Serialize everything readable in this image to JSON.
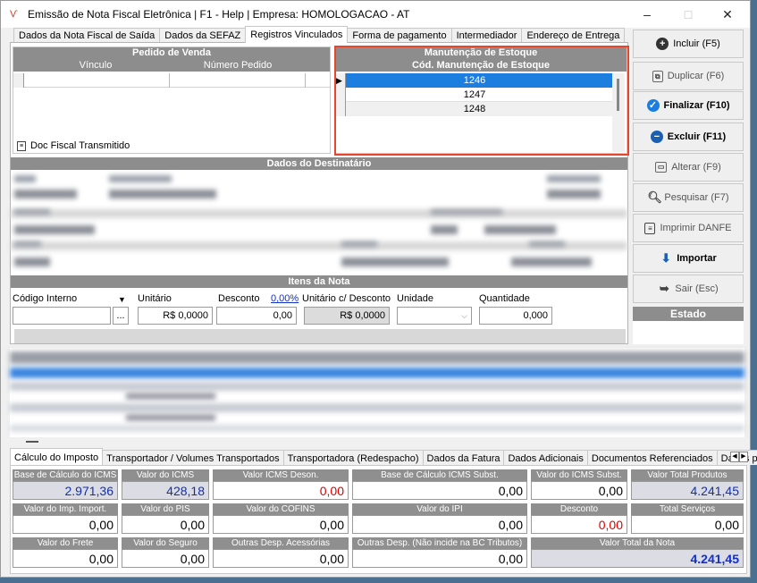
{
  "window": {
    "title": "Emissão de Nota Fiscal Eletrônica | F1 - Help | Empresa: HOMOLOGACAO - AT",
    "minimize": "–",
    "maximize": "□",
    "close": "✕"
  },
  "tabs": [
    "Dados da Nota Fiscal de Saída",
    "Dados da SEFAZ",
    "Registros Vinculados",
    "Forma de pagamento",
    "Intermediador",
    "Endereço de Entrega"
  ],
  "pedido": {
    "title": "Pedido de Venda",
    "col1": "Vínculo",
    "col2": "Número Pedido",
    "doc_label": "Doc Fiscal Transmitido"
  },
  "estoque": {
    "title": "Manutenção de Estoque",
    "col": "Cód. Manutenção de Estoque",
    "rows": [
      "1246",
      "1247",
      "1248"
    ]
  },
  "destinatario": {
    "title": "Dados  do Destinatário"
  },
  "itens": {
    "title": "Itens da Nota",
    "codigo_label": "Código Interno",
    "unitario_label": "Unitário",
    "desconto_label": "Desconto",
    "desconto_pct": "0,00%",
    "unit_desc_label": "Unitário c/ Desconto",
    "unidade_label": "Unidade",
    "quantidade_label": "Quantidade",
    "browse": "...",
    "unitario_value": "R$ 0,0000",
    "desconto_value": "0,00",
    "unit_desc_value": "R$ 0,0000",
    "quantidade_value": "0,000"
  },
  "buttons": {
    "incluir": "Incluir (F5)",
    "duplicar": "Duplicar (F6)",
    "finalizar": "Finalizar (F10)",
    "excluir": "Excluir (F11)",
    "alterar": "Alterar (F9)",
    "pesquisar": "Pesquisar (F7)",
    "imprimir": "Imprimir DANFE",
    "importar": "Importar",
    "sair": "Sair (Esc)",
    "estado": "Estado"
  },
  "bottom_tabs": [
    "Cálculo do Imposto",
    "Transportador / Volumes Transportados",
    "Transportadora (Redespacho)",
    "Dados da Fatura",
    "Dados Adicionais",
    "Documentos Referenciados",
    "Dados pa"
  ],
  "totais": {
    "base_icms": {
      "label": "Base de Cálculo do ICMS",
      "value": "2.971,36"
    },
    "valor_icms": {
      "label": "Valor do ICMS",
      "value": "428,18"
    },
    "icms_deson": {
      "label": "Valor ICMS Deson.",
      "value": "0,00"
    },
    "base_icms_st": {
      "label": "Base de Cálculo ICMS Subst.",
      "value": "0,00"
    },
    "valor_icms_st": {
      "label": "Valor do ICMS Subst.",
      "value": "0,00"
    },
    "total_produtos": {
      "label": "Valor Total Produtos",
      "value": "4.241,45"
    },
    "imp_import": {
      "label": "Valor do Imp. Import.",
      "value": "0,00"
    },
    "pis": {
      "label": "Valor do PIS",
      "value": "0,00"
    },
    "cofins": {
      "label": "Valor do COFINS",
      "value": "0,00"
    },
    "ipi": {
      "label": "Valor do IPI",
      "value": "0,00"
    },
    "desconto": {
      "label": "Desconto",
      "value": "0,00"
    },
    "servicos": {
      "label": "Total Serviços",
      "value": "0,00"
    },
    "frete": {
      "label": "Valor do Frete",
      "value": "0,00"
    },
    "seguro": {
      "label": "Valor do Seguro",
      "value": "0,00"
    },
    "outras": {
      "label": "Outras Desp. Acessórias",
      "value": "0,00"
    },
    "outras_nao": {
      "label": "Outras Desp. (Não incide na BC Tributos)",
      "value": "0,00"
    },
    "total_nota": {
      "label": "Valor Total da Nota",
      "value": "4.241,45"
    }
  },
  "colors": {
    "accent": "#0a78d7",
    "highlight": "#e8452c",
    "header_gray": "#8d8d8d"
  }
}
